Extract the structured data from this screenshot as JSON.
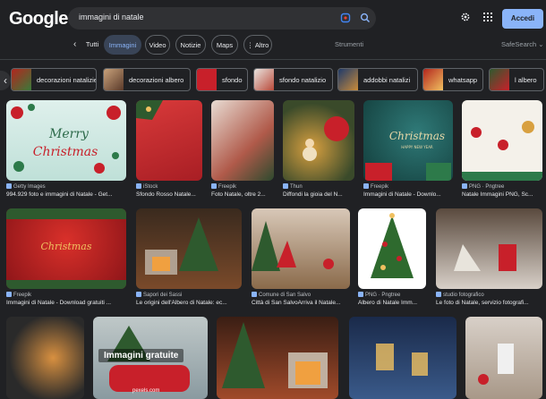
{
  "header": {
    "logo": "Google",
    "query": "immagini di natale",
    "signin_label": "Accedi"
  },
  "tabs": {
    "items": [
      {
        "label": "Tutti"
      },
      {
        "label": "Immagini"
      },
      {
        "label": "Video"
      },
      {
        "label": "Notizie"
      },
      {
        "label": "Maps"
      },
      {
        "label": "⋮ Altro"
      }
    ],
    "tools_label": "Strumenti",
    "safesearch_label": "SafeSearch ⌄"
  },
  "chips": [
    {
      "label": "decorazioni natalizie"
    },
    {
      "label": "decorazioni albero"
    },
    {
      "label": "sfondo"
    },
    {
      "label": "sfondo natalizio"
    },
    {
      "label": "addobbi natalizi"
    },
    {
      "label": "whatsapp"
    },
    {
      "label": "l albero"
    }
  ],
  "results": [
    {
      "source": "Getty Images",
      "caption": "994.929 foto e immagini di Natale - Get..."
    },
    {
      "source": "iStock",
      "caption": "Sfondo Rosso Natale..."
    },
    {
      "source": "Freepik",
      "caption": "Foto Natale, oltre 2..."
    },
    {
      "source": "Thun",
      "caption": "Diffondi la gioia del N..."
    },
    {
      "source": "Freepik",
      "caption": "Immagini di Natale - Downlo..."
    },
    {
      "source": "PNG · Pngtree",
      "caption": "Natale Immagini PNG, Sc..."
    },
    {
      "source": "Freepik",
      "caption": "Immagini di Natale - Download gratuiti ..."
    },
    {
      "source": "Sapori dei Sassi",
      "caption": "Le origini dell'Albero di Natale: ec..."
    },
    {
      "source": "Comune di San Salvo",
      "caption": "Città di San SalvoArriva il Natale..."
    },
    {
      "source": "PNG · Pngtree",
      "caption": "Albero di Natale Imm..."
    },
    {
      "source": "studio fotografico",
      "caption": "Le foto di Natale, servizio fotografi..."
    },
    {
      "source": "",
      "caption": ""
    },
    {
      "source": "",
      "caption": ""
    },
    {
      "source": "",
      "caption": ""
    },
    {
      "source": "",
      "caption": ""
    },
    {
      "source": "",
      "caption": ""
    }
  ],
  "overlay": {
    "title": "Immagini gratuite",
    "subtitle": "pexels.com"
  },
  "card_texts": {
    "merry": "Merry",
    "christmas": "Christmas",
    "christmas2": "Christmas",
    "happy": "HAPPY NEW YEAR"
  }
}
